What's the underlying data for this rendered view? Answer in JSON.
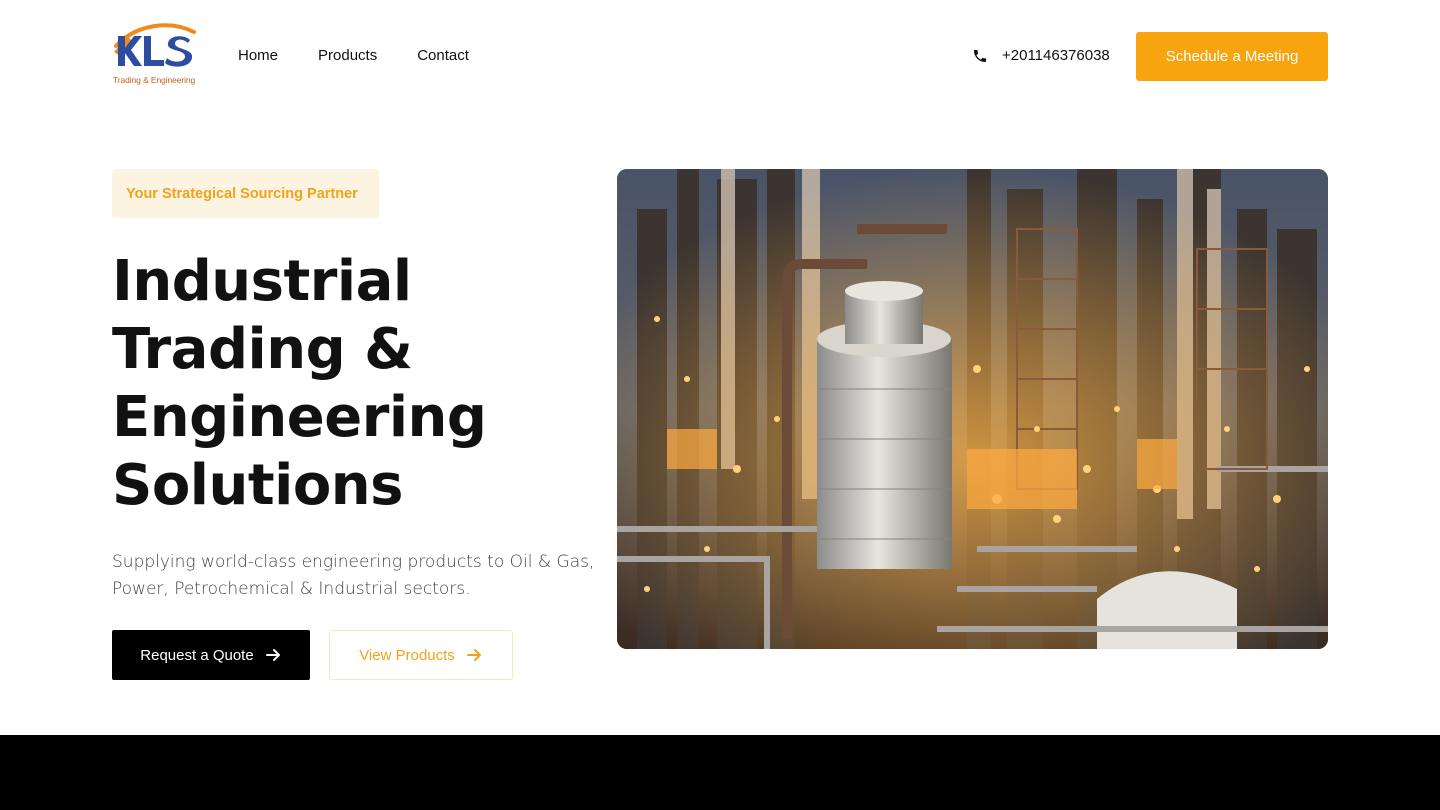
{
  "brand": {
    "logo_text": "KLS",
    "logo_subtext": "Trading & Engineering",
    "colors": {
      "accent": "#f7a40e",
      "logo_blue": "#2d4ea0",
      "logo_orange": "#f08a1c"
    }
  },
  "nav": {
    "items": [
      {
        "label": "Home"
      },
      {
        "label": "Products"
      },
      {
        "label": "Contact"
      }
    ]
  },
  "header": {
    "phone": "+201146376038",
    "phone_icon": "phone-icon",
    "cta_label": "Schedule a Meeting"
  },
  "hero": {
    "badge": "Your Strategical Sourcing Partner",
    "title_lines": [
      "Industrial",
      "Trading &",
      "Engineering",
      "Solutions"
    ],
    "subtitle": "Supplying world-class engineering products to Oil & Gas, Power, Petrochemical & Industrial sectors.",
    "primary_button": "Request a Quote",
    "secondary_button": "View Products",
    "image_subject": "industrial refinery at dusk"
  }
}
